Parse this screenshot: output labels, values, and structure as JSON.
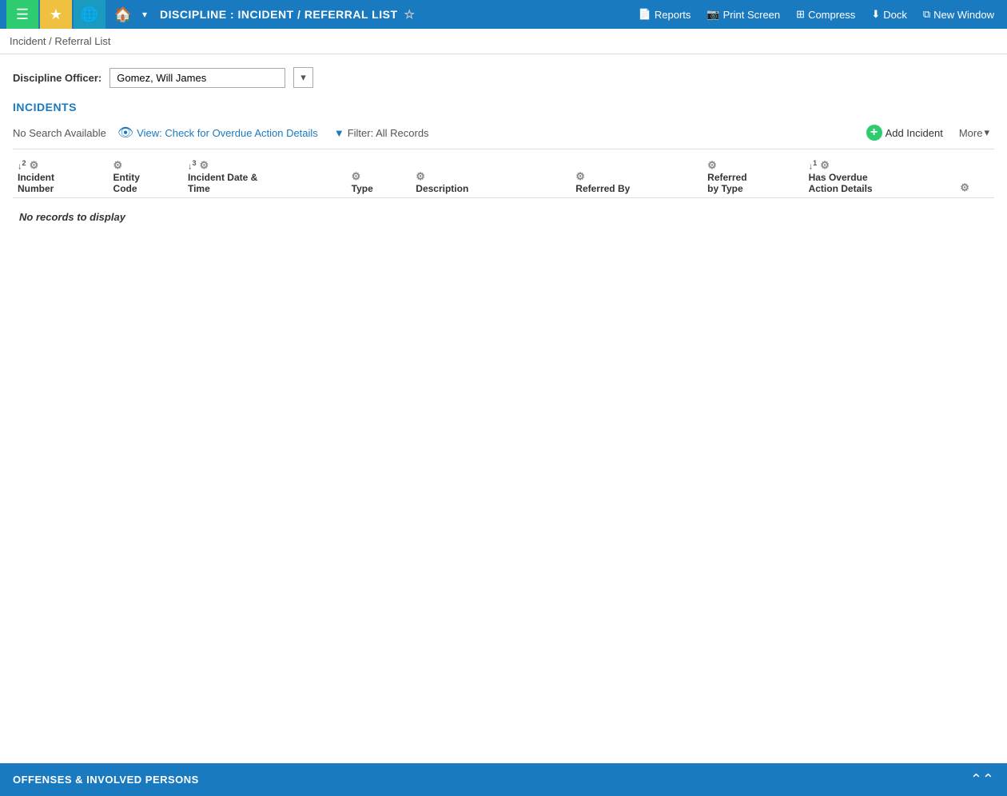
{
  "topbar": {
    "menu_icon": "☰",
    "star_icon": "★",
    "globe_icon": "🌐",
    "home_icon": "⌂",
    "chevron_icon": "∨",
    "title": "DISCIPLINE : INCIDENT / REFERRAL LIST",
    "star_outline": "☆",
    "reports_label": "Reports",
    "print_screen_label": "Print Screen",
    "compress_label": "Compress",
    "dock_label": "Dock",
    "new_window_label": "New Window"
  },
  "breadcrumb": {
    "text": "Incident / Referral List"
  },
  "officer_row": {
    "label": "Discipline Officer:",
    "value": "Gomez, Will James"
  },
  "incidents_section": {
    "title": "INCIDENTS",
    "no_search_label": "No Search Available",
    "view_label": "View: Check for Overdue Action Details",
    "filter_label": "Filter: All Records",
    "add_incident_label": "Add Incident",
    "more_label": "More",
    "columns": [
      {
        "sort": "↓2",
        "label": "Incident\nNumber"
      },
      {
        "sort": "",
        "label": "Entity\nCode"
      },
      {
        "sort": "↓3",
        "label": "Incident Date &\nTime"
      },
      {
        "sort": "",
        "label": "Type"
      },
      {
        "sort": "",
        "label": "Description"
      },
      {
        "sort": "",
        "label": "Referred By"
      },
      {
        "sort": "",
        "label": "Referred\nby Type"
      },
      {
        "sort": "↓1",
        "label": "Has Overdue\nAction Details"
      },
      {
        "sort": "",
        "label": ""
      }
    ],
    "no_records": "No records to display"
  },
  "bottom_section": {
    "title": "OFFENSES & INVOLVED PERSONS",
    "collapse_icon": "⌃⌃"
  }
}
